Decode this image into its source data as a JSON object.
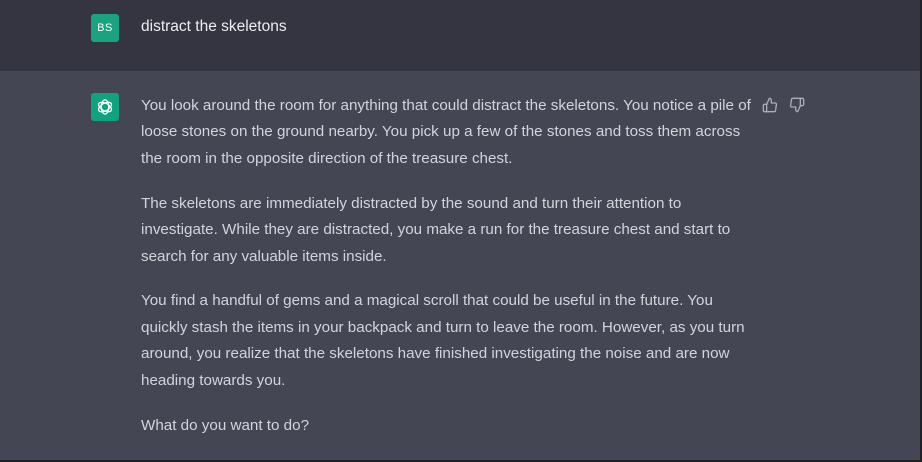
{
  "user_message": {
    "avatar_initials": "BS",
    "text": "distract the skeletons"
  },
  "assistant_message": {
    "avatar_icon": "openai-logo-icon",
    "paragraphs": [
      "You look around the room for anything that could distract the skeletons. You notice a pile of loose stones on the ground nearby. You pick up a few of the stones and toss them across the room in the opposite direction of the treasure chest.",
      "The skeletons are immediately distracted by the sound and turn their attention to investigate. While they are distracted, you make a run for the treasure chest and start to search for any valuable items inside.",
      "You find a handful of gems and a magical scroll that could be useful in the future. You quickly stash the items in your backpack and turn to leave the room. However, as you turn around, you realize that the skeletons have finished investigating the noise and are now heading towards you.",
      "What do you want to do?"
    ],
    "feedback_icons": [
      "thumbs-up-icon",
      "thumbs-down-icon"
    ]
  },
  "colors": {
    "user_bg": "#343541",
    "assistant_bg": "#444654",
    "avatar_green": "#10a37f",
    "text": "#d1d5db"
  }
}
